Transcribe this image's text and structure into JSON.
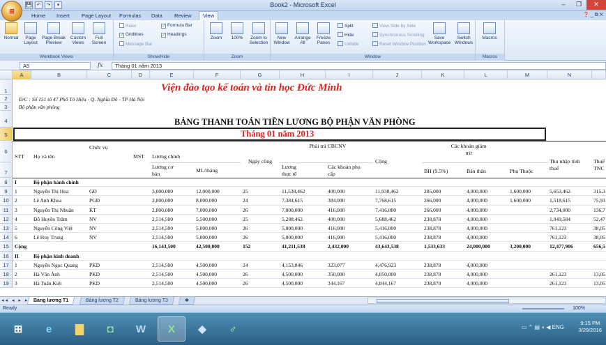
{
  "window": {
    "title": "Book2 - Microsoft Excel",
    "minimize": "–",
    "restore": "❐",
    "close": "✕"
  },
  "qat": [
    "💾",
    "↶",
    "↷",
    "▾"
  ],
  "tabs": [
    "Home",
    "Insert",
    "Page Layout",
    "Formulas",
    "Data",
    "Review",
    "View"
  ],
  "active_tab": "View",
  "ribbon_right": "❓ _ ⧉ ✕",
  "ribbon": {
    "workbook_views": {
      "label": "Workbook Views",
      "normal": "Normal",
      "page_layout": "Page Layout",
      "page_break": "Page Break Preview",
      "custom": "Custom Views",
      "full": "Full Screen"
    },
    "show_hide": {
      "label": "Show/Hide",
      "ruler": "Ruler",
      "gridlines": "Gridlines",
      "message_bar": "Message Bar",
      "formula_bar": "Formula Bar",
      "headings": "Headings"
    },
    "zoom": {
      "label": "Zoom",
      "zoom": "Zoom",
      "p100": "100%",
      "to_selection": "Zoom to Selection"
    },
    "window": {
      "label": "Window",
      "new": "New Window",
      "arrange": "Arrange All",
      "freeze": "Freeze Panes",
      "split": "Split",
      "hide": "Hide",
      "unhide": "Unhide",
      "side_by_side": "View Side by Side",
      "sync": "Synchronous Scrolling",
      "reset": "Reset Window Position",
      "save_ws": "Save Workspace",
      "switch": "Switch Windows"
    },
    "macros": {
      "label": "Macros",
      "macros": "Macros"
    }
  },
  "formula_bar": {
    "name_box": "A5",
    "fx": "fx",
    "value": "Tháng 01 năm 2013"
  },
  "columns": [
    "A",
    "B",
    "C",
    "D",
    "E",
    "F",
    "G",
    "H",
    "I",
    "J",
    "K",
    "L",
    "M",
    "N"
  ],
  "sheet": {
    "r1": "Viện đào tạo kế toán và tin học Đức Minh",
    "r2": "Đ/C : Số 151 tổ 47 Phố Tô Hiệu - Q. Nghĩa Đô - TP Hà Nội",
    "r3": "Bộ phận văn phòng",
    "r4": "BẢNG THANH TOÁN TIỀN LƯƠNG BỘ PHẬN VĂN PHÒNG",
    "r5": "Tháng 01 năm 2013",
    "h": {
      "stt": "STT",
      "name": "Họ và tên",
      "role": "Chức vụ",
      "mst": "MST",
      "salary": "Lương chính",
      "base": "Lương cơ bản",
      "ml": "ML/tháng",
      "days": "Ngày công",
      "paid": "Phải trả CBCNV",
      "actual": "Lương thực tế",
      "allow": "Các khoản phụ cấp",
      "total": "Cộng",
      "deduct": "Các khoản giảm trừ",
      "bh": "BH (9.5%)",
      "self": "Bản thân",
      "dep": "Phụ Thuộc",
      "taxable": "Thu nhập tính thuế",
      "tax": "Thuế TNC"
    },
    "sections": [
      {
        "row": "8",
        "a": "I",
        "b": "Bộ phận hành chính"
      },
      {
        "row": "16",
        "a": "II",
        "b": "Bộ phận kinh doanh"
      }
    ],
    "rows": [
      {
        "row": "9",
        "a": "1",
        "b": "Nguyễn Thị Hoa",
        "c": "GĐ",
        "e": "3,000,000",
        "f": "12,000,000",
        "g": "25",
        "h": "11,538,462",
        "i": "400,000",
        "j": "11,938,462",
        "k": "285,000",
        "l": "4,000,000",
        "m": "1,600,000",
        "n": "5,653,462",
        "o": "315,3"
      },
      {
        "row": "10",
        "a": "2",
        "b": "Lê Anh Khoa",
        "c": "PGĐ",
        "e": "2,800,000",
        "f": "8,000,000",
        "g": "24",
        "h": "7,384,615",
        "i": "384,000",
        "j": "7,768,615",
        "k": "266,000",
        "l": "4,000,000",
        "m": "1,600,000",
        "n": "1,518,615",
        "o": "75,93"
      },
      {
        "row": "11",
        "a": "3",
        "b": "Nguyễn Thị Nhuần",
        "c": "KT",
        "e": "2,800,000",
        "f": "7,000,000",
        "g": "26",
        "h": "7,000,000",
        "i": "416,000",
        "j": "7,416,000",
        "k": "266,000",
        "l": "4,000,000",
        "m": "",
        "n": "2,734,000",
        "o": "136,7"
      },
      {
        "row": "12",
        "a": "4",
        "b": "Đỗ Huyền Trâm",
        "c": "NV",
        "e": "2,514,500",
        "f": "5,500,000",
        "g": "25",
        "h": "5,288,462",
        "i": "400,000",
        "j": "5,688,462",
        "k": "238,878",
        "l": "4,000,000",
        "m": "",
        "n": "1,049,584",
        "o": "52,47"
      },
      {
        "row": "13",
        "a": "5",
        "b": "Nguyễn Công Việt",
        "c": "NV",
        "e": "2,514,500",
        "f": "5,000,000",
        "g": "26",
        "h": "5,000,000",
        "i": "416,000",
        "j": "5,416,000",
        "k": "238,878",
        "l": "4,000,000",
        "m": "",
        "n": "761,123",
        "o": "38,05"
      },
      {
        "row": "14",
        "a": "6",
        "b": "Lê Huy Trung",
        "c": "NV",
        "e": "2,514,500",
        "f": "5,000,000",
        "g": "26",
        "h": "5,000,000",
        "i": "416,000",
        "j": "5,416,000",
        "k": "238,878",
        "l": "4,000,000",
        "m": "",
        "n": "761,123",
        "o": "38,05"
      },
      {
        "row": "17",
        "a": "1",
        "b": "Nguyễn Ngọc Quang",
        "c": "PKD",
        "e": "2,514,500",
        "f": "4,500,000",
        "g": "24",
        "h": "4,153,846",
        "i": "323,077",
        "j": "4,476,923",
        "k": "238,878",
        "l": "4,000,000",
        "m": "",
        "n": "",
        "o": ""
      },
      {
        "row": "18",
        "a": "2",
        "b": "Hà Văn Ánh",
        "c": "PKD",
        "e": "2,514,500",
        "f": "4,500,000",
        "g": "26",
        "h": "4,500,000",
        "i": "350,000",
        "j": "4,850,000",
        "k": "238,878",
        "l": "4,000,000",
        "m": "",
        "n": "261,123",
        "o": "13,05"
      },
      {
        "row": "19",
        "a": "3",
        "b": "Hà Tuấn Kiệt",
        "c": "PKD",
        "e": "2,514,500",
        "f": "4,500,000",
        "g": "26",
        "h": "4,500,000",
        "i": "344,167",
        "j": "4,844,167",
        "k": "238,878",
        "l": "4,000,000",
        "m": "",
        "n": "261,123",
        "o": "13,05"
      }
    ],
    "total": {
      "row": "15",
      "label": "Cộng",
      "e": "16,143,500",
      "f": "42,500,000",
      "g": "152",
      "h": "41,211,538",
      "i": "2,432,000",
      "j": "43,643,538",
      "k": "1,533,633",
      "l": "24,000,000",
      "m": "3,200,000",
      "n": "12,477,906",
      "o": "656,5"
    },
    "row_numbers": [
      "1",
      "2",
      "3",
      "4",
      "5",
      "6",
      "7"
    ]
  },
  "sheet_tabs": [
    "Bảng lương T1",
    "Bảng lương T2",
    "Bảng lương T3"
  ],
  "active_sheet": "Bảng lương T1",
  "status": {
    "text": "Ready",
    "zoom": "100%"
  },
  "taskbar": {
    "time": "9:15 PM",
    "date": "3/29/2016",
    "lang": "ENG"
  }
}
